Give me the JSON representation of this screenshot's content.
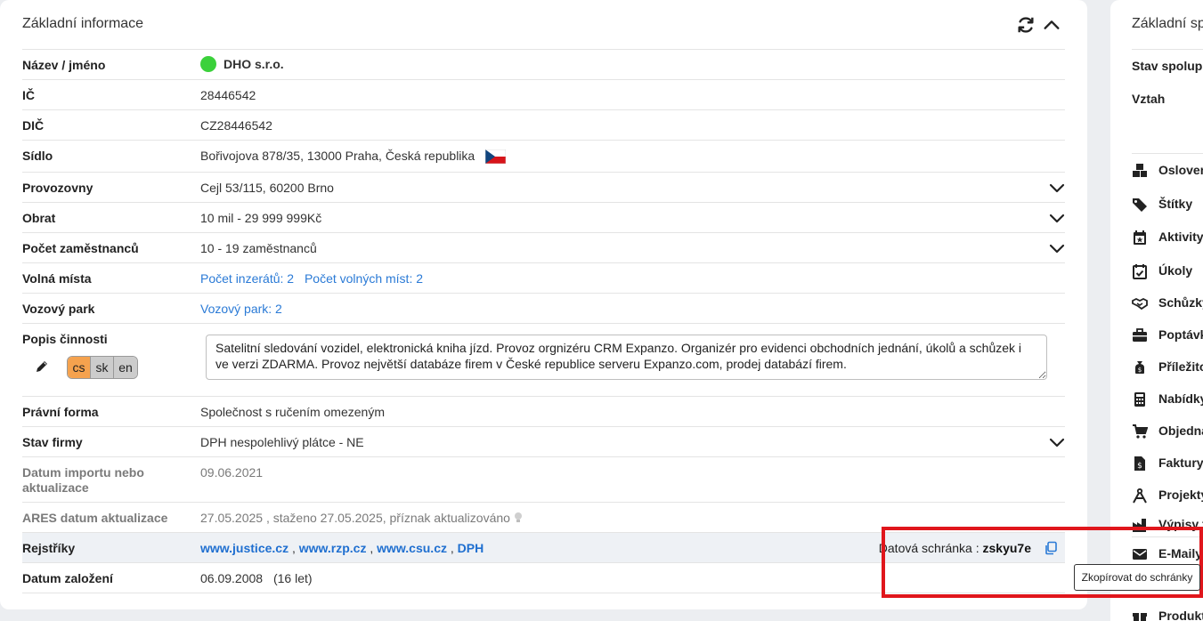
{
  "left_panel": {
    "title": "Základní informace",
    "rows": {
      "name": {
        "label": "Název / jméno",
        "value": "DHO s.r.o."
      },
      "ic": {
        "label": "IČ",
        "value": "28446542"
      },
      "dic": {
        "label": "DIČ",
        "value": "CZ28446542"
      },
      "sidlo": {
        "label": "Sídlo",
        "value": "Bořivojova 878/35, 13000 Praha, Česká republika"
      },
      "provozovny": {
        "label": "Provozovny",
        "value": "Cejl 53/115, 60200 Brno"
      },
      "obrat": {
        "label": "Obrat",
        "value": "10 mil - 29 999 999Kč"
      },
      "zamestnanci": {
        "label": "Počet zaměstnanců",
        "value": "10 - 19 zaměstnanců"
      },
      "volna_mista": {
        "label": "Volná místa",
        "link1": "Počet inzerátů: 2",
        "link2": "Počet volných míst: 2"
      },
      "vozovy_park": {
        "label": "Vozový park",
        "link": "Vozový park: 2"
      },
      "popis": {
        "label": "Popis činnosti",
        "langs": [
          "cs",
          "sk",
          "en"
        ],
        "text": "Satelitní sledování vozidel, elektronická kniha jízd. Provoz orgnizéru CRM Expanzo. Organizér pro evidenci obchodních jednání, úkolů a schůzek i ve verzi ZDARMA. Provoz největší databáze firem v České republice serveru Expanzo.com, prodej databází firem."
      },
      "pravni_forma": {
        "label": "Právní forma",
        "value": "Společnost s ručením omezeným"
      },
      "stav_firmy": {
        "label": "Stav firmy",
        "value": "DPH nespolehlivý plátce - NE"
      },
      "datum_importu": {
        "label": "Datum importu nebo aktualizace",
        "value": "09.06.2021"
      },
      "ares": {
        "label": "ARES datum aktualizace",
        "value": "27.05.2025 , staženo 27.05.2025, příznak aktualizováno"
      },
      "rejstriky": {
        "label": "Rejstříky",
        "links": [
          "www.justice.cz",
          "www.rzp.cz",
          "www.csu.cz",
          "DPH"
        ],
        "databox_label": "Datová schránka :",
        "databox_value": "zskyu7e"
      },
      "datum_zalozeni": {
        "label": "Datum založení",
        "value": "06.09.2008",
        "age": "(16 let)"
      }
    },
    "tooltip": "Zkopírovat do schránky"
  },
  "right_panel": {
    "title": "Základní sp",
    "stav_label": "Stav spolupra",
    "vztah_label": "Vztah",
    "items": [
      {
        "label": "Osloven",
        "icon": "cubes-icon"
      },
      {
        "label": "Štítky",
        "icon": "tags-icon"
      },
      {
        "label": "Aktivity",
        "icon": "calendar-star-icon"
      },
      {
        "label": "Úkoly",
        "icon": "calendar-check-icon"
      },
      {
        "label": "Schůzky",
        "icon": "handshake-icon"
      },
      {
        "label": "Poptávk",
        "icon": "briefcase-icon"
      },
      {
        "label": "Příležito",
        "icon": "money-bag-icon"
      },
      {
        "label": "Nabídky",
        "icon": "calculator-icon"
      },
      {
        "label": "Objedná",
        "icon": "cart-icon"
      },
      {
        "label": "Faktury",
        "icon": "invoice-icon"
      },
      {
        "label": "Projekty",
        "icon": "compass-icon"
      },
      {
        "label": "Výpisy f",
        "icon": "factory-icon"
      },
      {
        "label": "E-Maily",
        "icon": "envelope-icon"
      },
      {
        "label": "Produkt",
        "icon": "gift-icon"
      }
    ]
  },
  "colors": {
    "link": "#2a7ad6",
    "status_green": "#3bd13b",
    "lang_active": "#f5a24e",
    "highlight_red": "#e0161c"
  }
}
